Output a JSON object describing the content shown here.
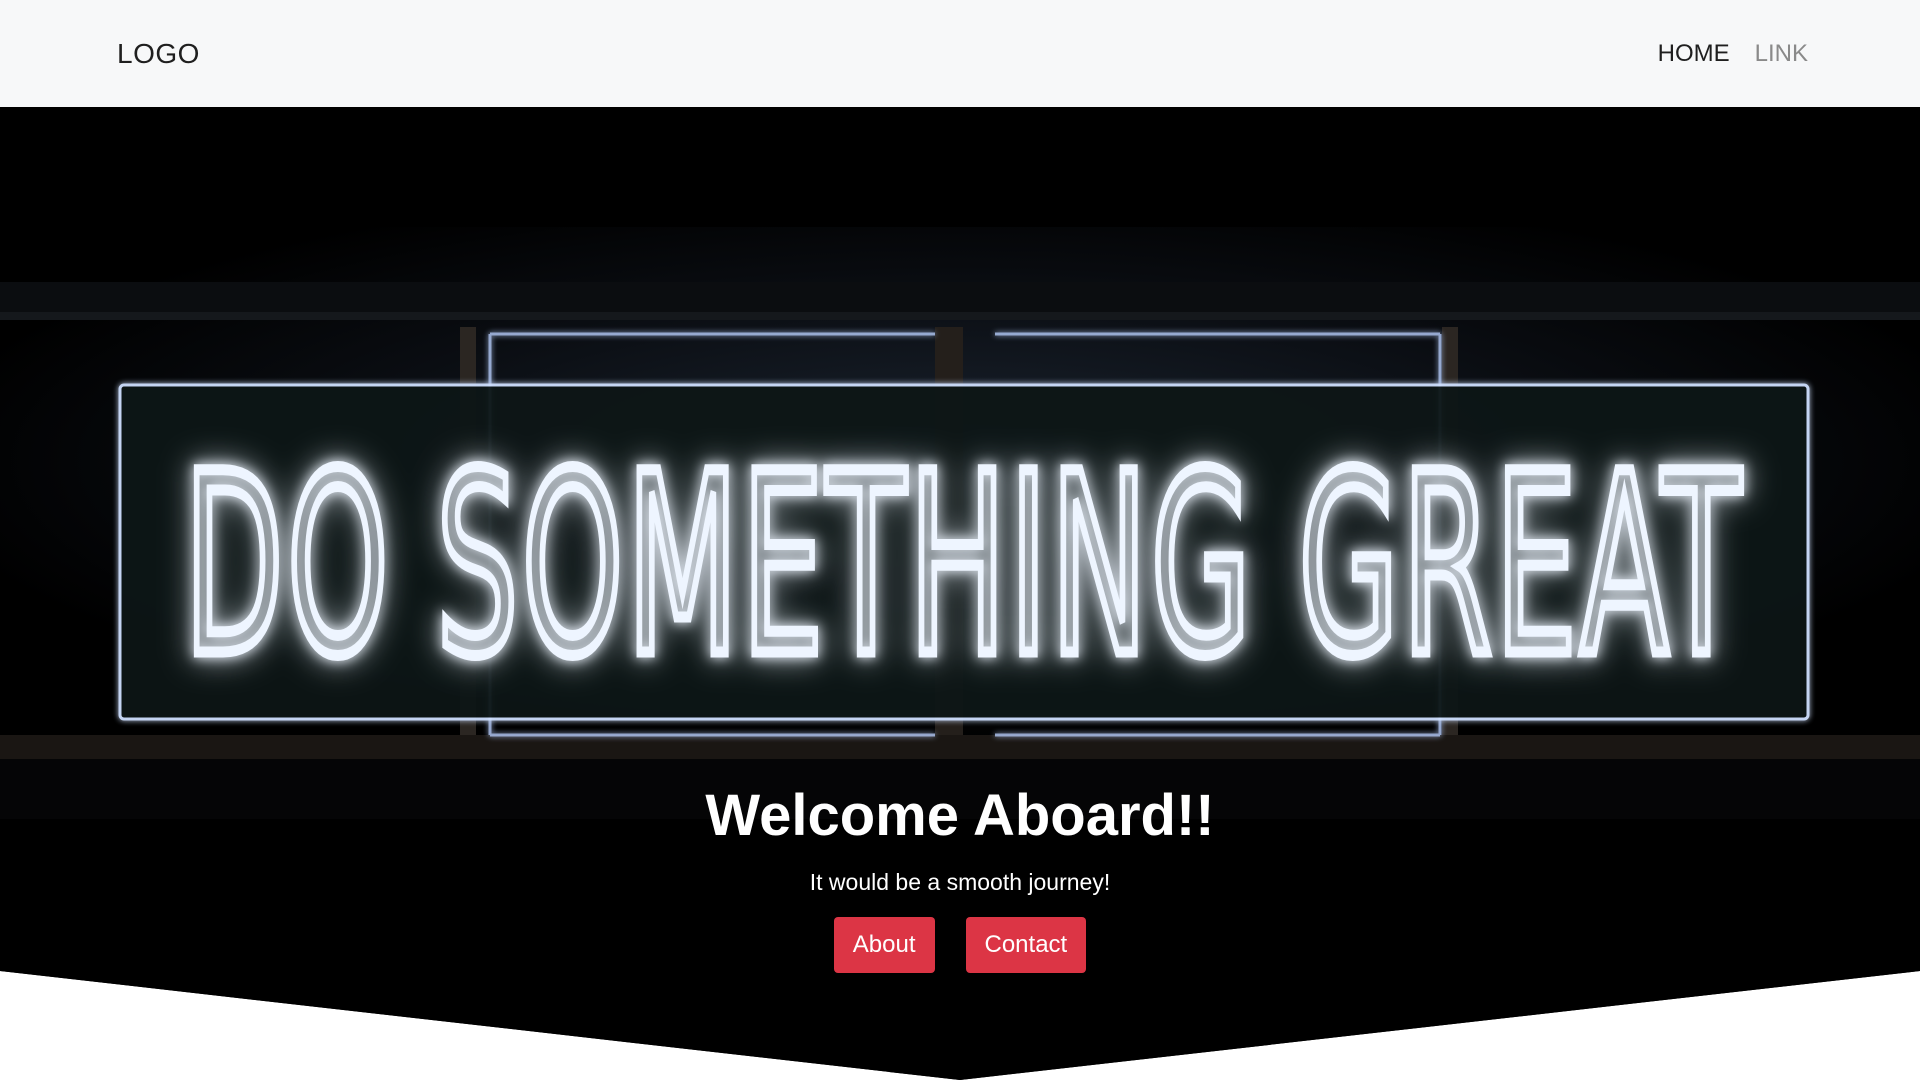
{
  "navbar": {
    "brand": "LOGO",
    "links": [
      {
        "label": "HOME",
        "active": true
      },
      {
        "label": "LINK",
        "active": false
      }
    ]
  },
  "hero": {
    "sign_text": "DO SOMETHING GREAT",
    "title": "Welcome Aboard!!",
    "subtitle": "It would be a smooth journey!",
    "buttons": [
      {
        "label": "About"
      },
      {
        "label": "Contact"
      }
    ]
  },
  "colors": {
    "navbar_bg": "#f7f8f9",
    "hero_bg": "#000000",
    "button_bg": "#dc3545",
    "neon": "#e8f1ff",
    "neon_glow": "#8fb2ff"
  }
}
